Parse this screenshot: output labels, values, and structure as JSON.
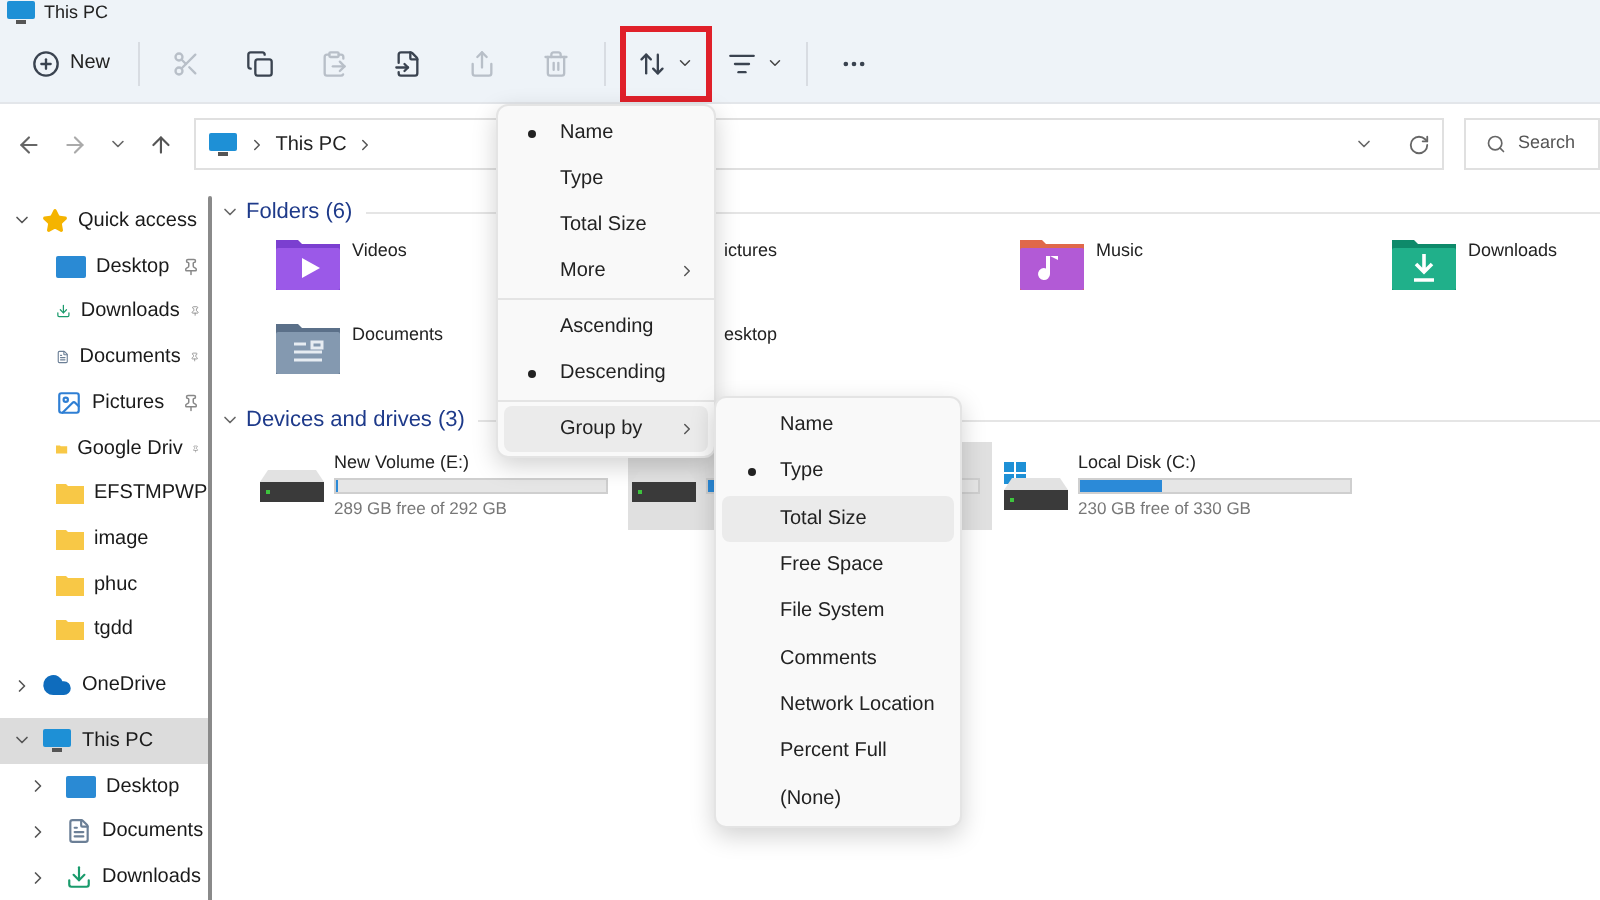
{
  "window": {
    "title": "This PC"
  },
  "toolbar": {
    "items": [
      {
        "kind": "new",
        "label": "New",
        "disabled": false,
        "highlighted": false
      },
      {
        "kind": "cut",
        "disabled": true,
        "highlighted": false
      },
      {
        "kind": "copy",
        "disabled": false,
        "highlighted": false
      },
      {
        "kind": "paste",
        "disabled": true,
        "highlighted": false
      },
      {
        "kind": "rename",
        "disabled": false,
        "highlighted": false
      },
      {
        "kind": "share",
        "disabled": true,
        "highlighted": false
      },
      {
        "kind": "delete",
        "disabled": true,
        "highlighted": false
      },
      {
        "kind": "sort",
        "disabled": false,
        "highlighted": true
      },
      {
        "kind": "view",
        "disabled": false,
        "highlighted": false
      },
      {
        "kind": "more",
        "disabled": false,
        "highlighted": false
      }
    ]
  },
  "address": {
    "path": [
      "This PC"
    ]
  },
  "search": {
    "placeholder": "Search"
  },
  "sidebar": {
    "items": [
      {
        "label": "Quick access",
        "kind": "star",
        "expanded": true,
        "selected": false,
        "children": [
          {
            "label": "Desktop",
            "kind": "desktop",
            "pinned": true
          },
          {
            "label": "Downloads",
            "kind": "download",
            "pinned": true
          },
          {
            "label": "Documents",
            "kind": "document",
            "pinned": true
          },
          {
            "label": "Pictures",
            "kind": "picture",
            "pinned": true
          },
          {
            "label": "Google Driv",
            "kind": "folder",
            "pinned": true
          },
          {
            "label": "EFSTMPWP",
            "kind": "folder",
            "pinned": false
          },
          {
            "label": "image",
            "kind": "folder",
            "pinned": false
          },
          {
            "label": "phuc",
            "kind": "folder",
            "pinned": false
          },
          {
            "label": "tgdd",
            "kind": "folder",
            "pinned": false
          }
        ]
      },
      {
        "label": "OneDrive",
        "kind": "cloud",
        "expanded": false,
        "selected": false
      },
      {
        "label": "This PC",
        "kind": "pc",
        "expanded": true,
        "selected": true,
        "children": [
          {
            "label": "Desktop",
            "kind": "desktop",
            "pinned": false
          },
          {
            "label": "Documents",
            "kind": "document",
            "pinned": false
          },
          {
            "label": "Downloads",
            "kind": "download",
            "pinned": false
          }
        ]
      }
    ]
  },
  "folders": {
    "title": "Folders (6)",
    "expanded": true,
    "items": [
      {
        "name": "Videos",
        "kind": "videos"
      },
      {
        "name": "ictures",
        "kind": "pictures"
      },
      {
        "name": "Music",
        "kind": "music"
      },
      {
        "name": "Downloads",
        "kind": "downloads"
      },
      {
        "name": "Documents",
        "kind": "documents"
      },
      {
        "name": "esktop",
        "kind": "desktop"
      }
    ]
  },
  "drives": {
    "title": "Devices and drives (3)",
    "expanded": true,
    "items": [
      {
        "name": "New Volume (E:)",
        "free": "289 GB free of 292 GB",
        "level": 0.01,
        "kind": "disk",
        "selected": false
      },
      {
        "level": 0.03,
        "kind": "disk",
        "selected": true
      },
      {
        "name": "Local Disk (C:)",
        "free": "230 GB free of 330 GB",
        "level": 0.3,
        "kind": "system",
        "selected": false
      }
    ]
  },
  "sort_menu": {
    "items": [
      {
        "kind": "option",
        "label": "Name",
        "selected": true,
        "highlighted": false
      },
      {
        "kind": "option",
        "label": "Type",
        "selected": false,
        "highlighted": false
      },
      {
        "kind": "option",
        "label": "Total Size",
        "selected": false,
        "highlighted": false
      },
      {
        "kind": "submenu",
        "label": "More",
        "selected": false,
        "highlighted": false
      },
      {
        "kind": "separator"
      },
      {
        "kind": "option",
        "label": "Ascending",
        "selected": false,
        "highlighted": false
      },
      {
        "kind": "option",
        "label": "Descending",
        "selected": true,
        "highlighted": false
      },
      {
        "kind": "separator"
      },
      {
        "kind": "submenu",
        "label": "Group by",
        "selected": false,
        "highlighted": true
      }
    ]
  },
  "group_menu": {
    "items": [
      {
        "label": "Name",
        "selected": false,
        "highlighted": false
      },
      {
        "label": "Type",
        "selected": true,
        "highlighted": false
      },
      {
        "label": "Total Size",
        "selected": false,
        "highlighted": true
      },
      {
        "label": "Free Space",
        "selected": false,
        "highlighted": false
      },
      {
        "label": "File System",
        "selected": false,
        "highlighted": false
      },
      {
        "label": "Comments",
        "selected": false,
        "highlighted": false
      },
      {
        "label": "Network Location",
        "selected": false,
        "highlighted": false
      },
      {
        "label": "Percent Full",
        "selected": false,
        "highlighted": false
      },
      {
        "label": "(None)",
        "selected": false,
        "highlighted": false
      }
    ]
  }
}
